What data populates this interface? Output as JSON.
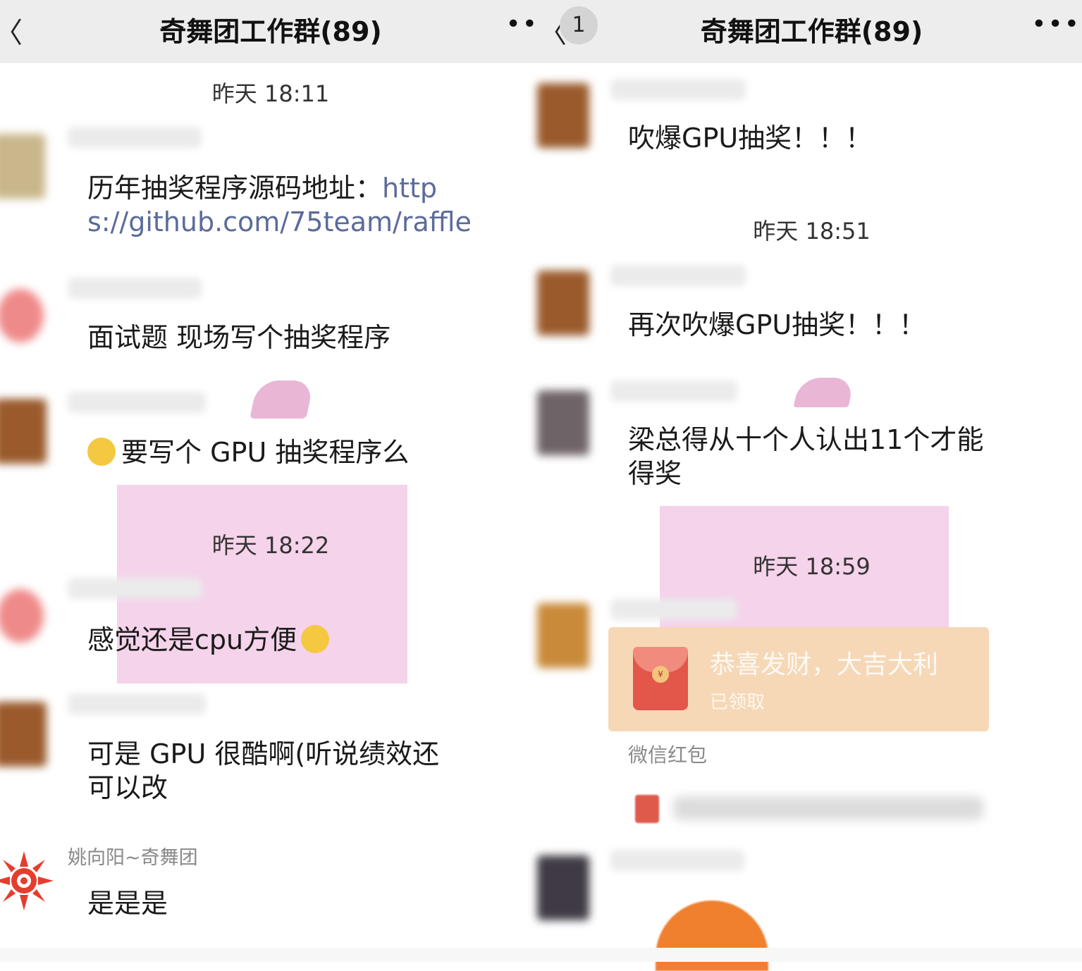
{
  "left": {
    "header": {
      "back": "〈",
      "title": "奇舞团工作群(89)",
      "more": "••"
    },
    "times": [
      "昨天 18:11",
      "昨天 18:22"
    ],
    "messages": {
      "m1_text": "历年抽奖程序源码地址：",
      "m1_link_a": "http",
      "m1_link_b": "s://github.com/75team/raffle",
      "m2": "面试题 现场写个抽奖程序",
      "m3": "要写个 GPU 抽奖程序么",
      "m4": "感觉还是cpu方便",
      "m5_line1": "可是 GPU 很酷啊(听说绩效还",
      "m5_line2": "可以改",
      "m6_sender": "姚向阳~奇舞团",
      "m6": "是是是"
    }
  },
  "right": {
    "header": {
      "back": "〈",
      "badge": "1",
      "title": "奇舞团工作群(89)",
      "more": "•••"
    },
    "times": [
      "昨天 18:51",
      "昨天 18:59"
    ],
    "messages": {
      "r1": "吹爆GPU抽奖！！！",
      "r2": "再次吹爆GPU抽奖！！！",
      "r3_line1": "梁总得从十个人认出11个才能",
      "r3_line2": "得奖"
    },
    "red_packet": {
      "title": "恭喜发财，大吉大利",
      "status": "已领取",
      "label": "微信红包",
      "coin": "¥"
    }
  },
  "colors": {
    "header_bg": "#ededed",
    "link": "#5b6b9a",
    "red_packet": "#f6d8b7",
    "watermark": "#f5d3ea"
  }
}
